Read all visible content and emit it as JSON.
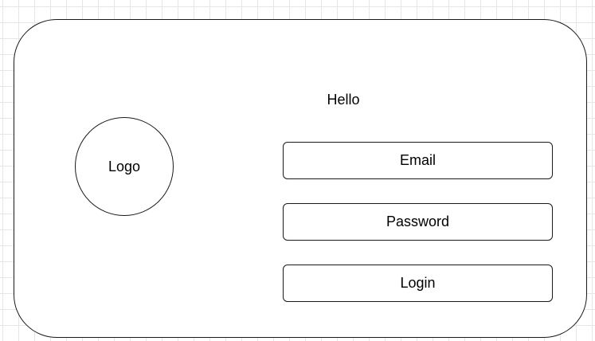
{
  "logo": {
    "label": "Logo"
  },
  "greeting": "Hello",
  "form": {
    "email_label": "Email",
    "password_label": "Password",
    "login_label": "Login"
  }
}
